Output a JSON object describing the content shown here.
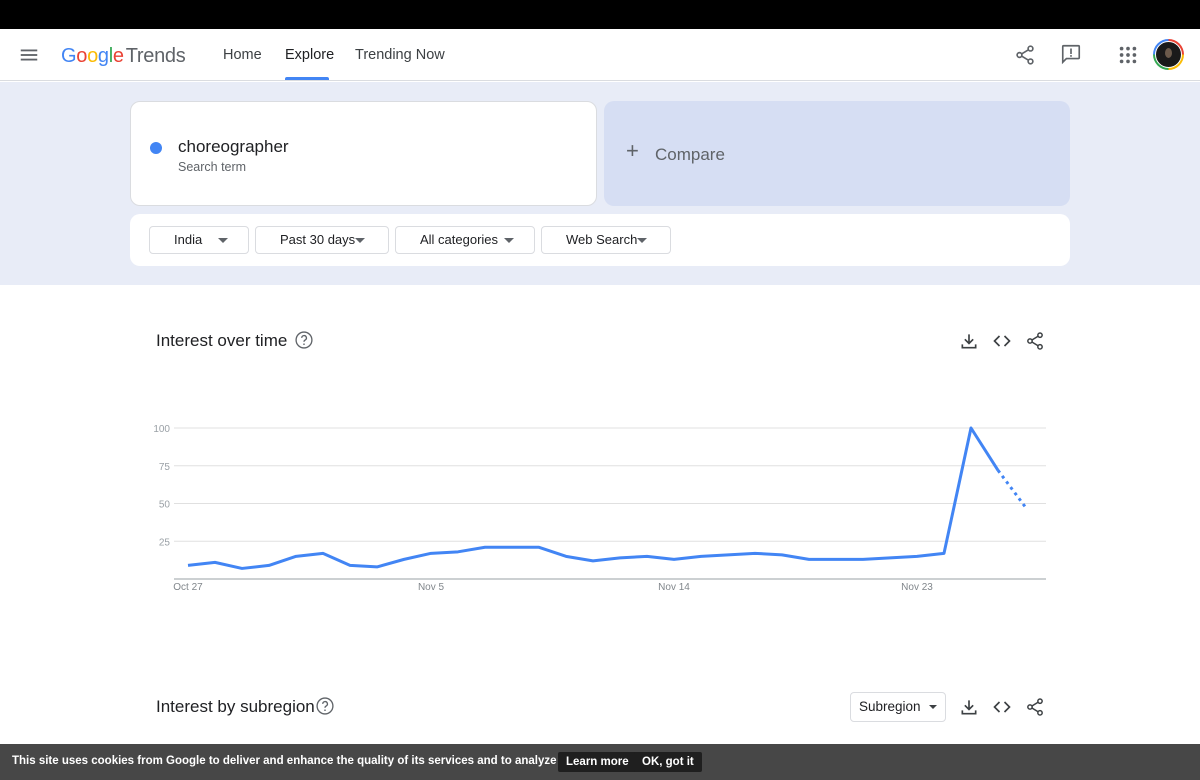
{
  "header": {
    "logo_letters": [
      "G",
      "o",
      "o",
      "g",
      "l",
      "e"
    ],
    "logo_product": "Trends",
    "nav": [
      {
        "label": "Home"
      },
      {
        "label": "Explore"
      },
      {
        "label": "Trending Now"
      }
    ],
    "active_tab": "Explore"
  },
  "search": {
    "term": "choreographer",
    "term_sublabel": "Search term",
    "term_color": "#4285f4",
    "compare_label": "Compare"
  },
  "filters": {
    "region": "India",
    "time_range": "Past 30 days",
    "category": "All categories",
    "search_type": "Web Search"
  },
  "interest_over_time": {
    "title": "Interest over time",
    "chart_data": {
      "type": "line",
      "y_ticks": [
        "100",
        "75",
        "50",
        "25"
      ],
      "x_ticks": [
        "Oct 27",
        "Nov 5",
        "Nov 14",
        "Nov 23"
      ],
      "ylim": [
        0,
        100
      ],
      "grid": true,
      "series": [
        {
          "color": "#4285f4",
          "x": [
            "Oct 27",
            "Oct 28",
            "Oct 29",
            "Oct 30",
            "Oct 31",
            "Nov 1",
            "Nov 2",
            "Nov 3",
            "Nov 4",
            "Nov 5",
            "Nov 6",
            "Nov 7",
            "Nov 8",
            "Nov 9",
            "Nov 10",
            "Nov 11",
            "Nov 12",
            "Nov 13",
            "Nov 14",
            "Nov 15",
            "Nov 16",
            "Nov 17",
            "Nov 18",
            "Nov 19",
            "Nov 20",
            "Nov 21",
            "Nov 22",
            "Nov 23",
            "Nov 24",
            "Nov 25",
            "Nov 26",
            "Nov 27",
            "Nov 28"
          ],
          "values": [
            9,
            11,
            7,
            9,
            15,
            17,
            9,
            8,
            13,
            17,
            18,
            21,
            21,
            21,
            15,
            12,
            14,
            15,
            13,
            15,
            16,
            17,
            16,
            13,
            13,
            13,
            14,
            15,
            17,
            100,
            72,
            48
          ],
          "partial_from_index": 30
        }
      ]
    }
  },
  "interest_by_subregion": {
    "title": "Interest by subregion",
    "select_label": "Subregion"
  },
  "cookie_banner": {
    "text": "This site uses cookies from Google to deliver and enhance the quality of its services and to analyze traffic.",
    "learn_more": "Learn more",
    "ok": "OK, got it"
  }
}
